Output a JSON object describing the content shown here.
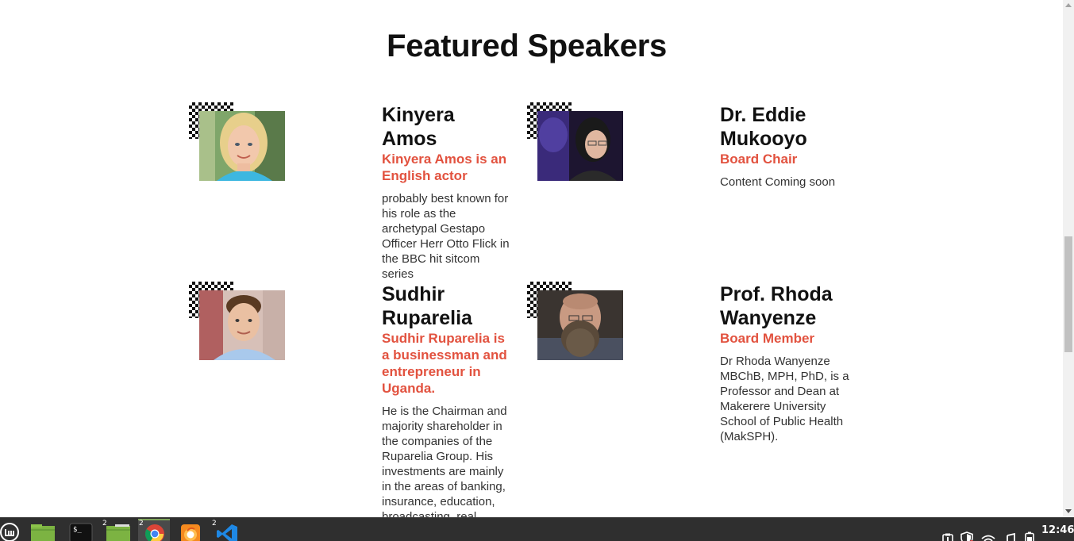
{
  "section": {
    "title": "Featured Speakers"
  },
  "speakers": [
    {
      "name": "Kinyera Amos",
      "role": "Kinyera Amos is an English actor",
      "bio": "probably best known for his role as the archetypal Gestapo Officer Herr Otto Flick in the BBC hit sitcom series"
    },
    {
      "name": "Dr. Eddie Mukooyo",
      "role": "Board Chair",
      "bio": "Content Coming soon"
    },
    {
      "name": "Sudhir Ruparelia",
      "role": "Sudhir Ruparelia is a businessman and entrepreneur in Uganda.",
      "bio": "He is the Chairman and majority shareholder in the companies of the Ruparelia Group. His investments are mainly in the areas of banking, insurance, education, broadcasting, real"
    },
    {
      "name": "Prof. Rhoda Wanyenze",
      "role": "Board Member",
      "bio": "Dr Rhoda Wanyenze MBChB, MPH, PhD, is a Professor and Dean at Makerere University School of Public Health (MakSPH)."
    }
  ],
  "taskbar": {
    "items": [
      {
        "icon": "mint-menu-icon",
        "badge": ""
      },
      {
        "icon": "files-icon",
        "badge": ""
      },
      {
        "icon": "terminal-icon",
        "badge": ""
      },
      {
        "icon": "files-icon",
        "badge": "2"
      },
      {
        "icon": "chrome-icon",
        "badge": "2"
      },
      {
        "icon": "firefox-icon",
        "badge": ""
      },
      {
        "icon": "vscode-icon",
        "badge": "2"
      }
    ],
    "clock": "12:46",
    "tray_icons": [
      "clipboard-icon",
      "shield-icon",
      "wifi-icon",
      "music-icon",
      "battery-icon"
    ]
  },
  "colors": {
    "accent": "#e2523f",
    "taskbar_bg": "#2f2f2f"
  }
}
